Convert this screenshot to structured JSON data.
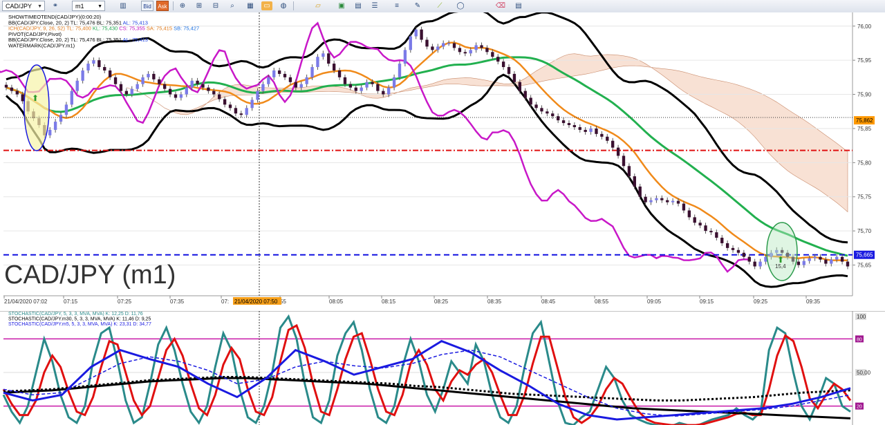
{
  "toolbar": {
    "symbol": "CAD/JPY",
    "timeframe": "m1",
    "bid_label": "Bid",
    "ask_label": "Ask",
    "icons": [
      "chart-type-icon",
      "bar-chart-icon",
      "crosshair-icon",
      "zoom-in-icon",
      "zoom-out-icon",
      "magnifier-icon",
      "indicator-icon",
      "globe-icon",
      "ruler-icon",
      "picture-icon",
      "template-icon",
      "list-icon",
      "lines-menu-icon",
      "pen-icon",
      "trendline-icon",
      "shape-icon",
      "eraser-icon",
      "properties-icon"
    ]
  },
  "chart_data": [
    {
      "type": "candlestick",
      "title": "CAD/JPY (m1)",
      "legend": [
        {
          "text": "SHOWTIMEOTEND(CAD/JPY)(0:00:20)",
          "color": "#000000"
        },
        {
          "parts": [
            {
              "text": "BB(CAD/JPY.Close, 20, 2)  TL: 75,476  BL: 75,351  ",
              "color": "#000000"
            },
            {
              "text": "AL: 75,413",
              "color": "#1a3fe0"
            }
          ]
        },
        {
          "parts": [
            {
              "text": "ICH(CAD/JPY, 9, 26, 52)  ",
              "color": "#e07a1a"
            },
            {
              "text": "TL: 75,400  ",
              "color": "#e07a1a"
            },
            {
              "text": "KL: 75,430  ",
              "color": "#1fa84f"
            },
            {
              "text": "CS: 75,355  ",
              "color": "#c010c0"
            },
            {
              "text": "SA: 75,415  ",
              "color": "#e07a1a"
            },
            {
              "text": "SB: 75,427",
              "color": "#1a6fe0"
            }
          ]
        },
        {
          "text": "PIVOT(CAD/JPY,Pivot)",
          "color": "#000000"
        },
        {
          "parts": [
            {
              "text": "BB(CAD/JPY.Close, 20, 2)  TL: 75,476  BL: 75,351  ",
              "color": "#000000"
            },
            {
              "text": "AL: 75,413",
              "color": "#1a3fe0"
            }
          ]
        },
        {
          "text": "WATERMARK(CAD/JPY.m1)",
          "color": "#000000"
        }
      ],
      "y_axis": {
        "ylim": [
          75.605,
          76.02
        ],
        "ticks": [
          "76,00",
          "75,95",
          "75,90",
          "75,85",
          "75,80",
          "75,75",
          "75,70",
          "75,65"
        ],
        "tick_values": [
          76.0,
          75.95,
          75.9,
          75.85,
          75.8,
          75.75,
          75.7,
          75.65
        ]
      },
      "x_axis": {
        "ticks": [
          "21/04/2020 07:02",
          "07:15",
          "07:25",
          "07:35",
          "07:",
          "55",
          "08:05",
          "08:15",
          "08:25",
          "08:35",
          "08:45",
          "08:55",
          "09:05",
          "09:15",
          "09:25",
          "09:35"
        ],
        "crosshair_label": "21/04/2020 07:50"
      },
      "price_markers": [
        {
          "label": "75,862",
          "value": 75.862,
          "color": "#ff9900"
        },
        {
          "label": "75,665",
          "value": 75.665,
          "color": "#1a1ae0"
        }
      ],
      "horizontal_lines": [
        {
          "value": 75.818,
          "color": "#e01010",
          "style": "dash-dot"
        },
        {
          "value": 75.665,
          "color": "#1010e0",
          "style": "dashed"
        }
      ],
      "annotations": [
        {
          "text": "15,4",
          "note": "arrow label"
        }
      ],
      "candles_close": [
        75.91,
        75.905,
        75.9,
        75.89,
        75.875,
        75.865,
        75.855,
        75.84,
        75.848,
        75.86,
        75.87,
        75.885,
        75.905,
        75.92,
        75.935,
        75.945,
        75.95,
        75.94,
        75.935,
        75.925,
        75.915,
        75.905,
        75.9,
        75.908,
        75.915,
        75.925,
        75.93,
        75.922,
        75.915,
        75.908,
        75.9,
        75.895,
        75.9,
        75.91,
        75.92,
        75.915,
        75.91,
        75.905,
        75.9,
        75.893,
        75.885,
        75.88,
        75.872,
        75.87,
        75.88,
        75.892,
        75.905,
        75.915,
        75.925,
        75.935,
        75.93,
        75.925,
        75.918,
        75.91,
        75.915,
        75.925,
        75.94,
        75.955,
        75.96,
        75.945,
        75.935,
        75.925,
        75.915,
        75.91,
        75.905,
        75.91,
        75.918,
        75.915,
        75.905,
        75.9,
        75.91,
        75.925,
        75.945,
        75.965,
        75.985,
        75.995,
        75.98,
        75.97,
        75.965,
        75.97,
        75.975,
        75.975,
        75.968,
        75.962,
        75.96,
        75.965,
        75.972,
        75.968,
        75.962,
        75.955,
        75.948,
        75.94,
        75.93,
        75.918,
        75.905,
        75.895,
        75.885,
        75.88,
        75.875,
        75.872,
        75.868,
        75.862,
        75.858,
        75.855,
        75.852,
        75.848,
        75.845,
        75.85,
        75.842,
        75.838,
        75.832,
        75.822,
        75.81,
        75.795,
        75.78,
        75.765,
        75.75,
        75.742,
        75.745,
        75.748,
        75.745,
        75.742,
        75.744,
        75.74,
        75.73,
        75.72,
        75.712,
        75.708,
        75.7,
        75.698,
        75.69,
        75.682,
        75.675,
        75.672,
        75.668,
        75.662,
        75.655,
        75.648,
        75.655,
        75.662,
        75.668,
        75.672,
        75.668,
        75.662,
        75.655,
        75.65,
        75.656,
        75.66,
        75.662,
        75.658,
        75.652,
        75.658,
        75.662,
        75.655,
        75.648
      ]
    },
    {
      "type": "line",
      "title": "",
      "legend": [
        {
          "text": "STOCHASTIC(CAD/JPY, 5, 3, 3, MVA, MVA)  K: 12,25  D: 11,76",
          "color": "#2a8a8a",
          "dcolor": "#e01010"
        },
        {
          "text": "STOCHASTIC(CAD/JPY.m30, 5, 3, 3, MVA, MVA)  K: 11,46  D: 9,25",
          "color": "#000000"
        },
        {
          "text": "STOCHASTIC(CAD/JPY.m5, 5, 3, 3, MVA, MVA)  K: 23,31  D: 34,77",
          "color": "#1a1ae0"
        }
      ],
      "y_axis": {
        "ylim": [
          0,
          100
        ],
        "ticks": [
          "100",
          "50,00"
        ],
        "tick_values": [
          100,
          50
        ]
      },
      "overbought": 80,
      "oversold": 20,
      "marker_labels": [
        "80",
        "20",
        "100"
      ],
      "series": [
        {
          "name": "K",
          "color": "#2a8a8a",
          "values": [
            30,
            15,
            5,
            20,
            50,
            80,
            60,
            30,
            10,
            5,
            20,
            60,
            85,
            90,
            60,
            25,
            5,
            10,
            40,
            75,
            90,
            70,
            40,
            15,
            5,
            20,
            55,
            85,
            70,
            35,
            10,
            5,
            20,
            50,
            90,
            100,
            80,
            40,
            10,
            5,
            25,
            65,
            85,
            95,
            70,
            35,
            10,
            5,
            20,
            55,
            80,
            60,
            30,
            15,
            35,
            60,
            50,
            40,
            75,
            60,
            30,
            10,
            5,
            20,
            55,
            85,
            95,
            60,
            25,
            5,
            3,
            10,
            15,
            35,
            55,
            45,
            25,
            12,
            8,
            5,
            3,
            2,
            2,
            5,
            3,
            2,
            5,
            8,
            10,
            12,
            18,
            12,
            8,
            15,
            70,
            90,
            85,
            50,
            20,
            8,
            25,
            45,
            40,
            20,
            15
          ]
        },
        {
          "name": "D",
          "color": "#e01010",
          "values": [
            35,
            22,
            12,
            12,
            25,
            50,
            65,
            55,
            33,
            15,
            12,
            28,
            55,
            78,
            75,
            50,
            25,
            12,
            20,
            45,
            70,
            80,
            65,
            40,
            18,
            12,
            30,
            57,
            72,
            62,
            35,
            15,
            12,
            28,
            60,
            88,
            92,
            72,
            40,
            15,
            12,
            35,
            62,
            82,
            85,
            62,
            35,
            15,
            12,
            30,
            58,
            70,
            57,
            35,
            25,
            42,
            52,
            48,
            57,
            62,
            50,
            30,
            12,
            12,
            30,
            58,
            82,
            82,
            55,
            28,
            10,
            5,
            10,
            20,
            35,
            45,
            40,
            27,
            15,
            8,
            5,
            4,
            3,
            3,
            3,
            3,
            4,
            6,
            8,
            10,
            13,
            14,
            12,
            12,
            35,
            65,
            83,
            78,
            55,
            27,
            18,
            30,
            40,
            35,
            25
          ]
        },
        {
          "name": "K m30",
          "color": "#000000",
          "values": [
            32,
            33,
            34,
            36,
            38,
            40,
            42,
            43,
            44,
            45,
            45,
            44,
            43,
            42,
            41,
            40,
            38,
            36,
            34,
            32,
            30,
            28,
            26,
            24,
            22,
            20,
            18,
            17,
            16,
            15,
            14,
            13,
            12,
            11,
            10,
            9
          ]
        },
        {
          "name": "D m30",
          "color": "#000000",
          "style": "dotted",
          "values": [
            33,
            34,
            35,
            37,
            39,
            41,
            43,
            44,
            45,
            46,
            46,
            45,
            44,
            43,
            42,
            41,
            40,
            38,
            37,
            35,
            33,
            31,
            30,
            29,
            28,
            27,
            26,
            25,
            25,
            26,
            27,
            28,
            30,
            32,
            33,
            34
          ]
        },
        {
          "name": "K m5",
          "color": "#1a1ae0",
          "values": [
            32,
            25,
            30,
            55,
            70,
            62,
            55,
            40,
            28,
            45,
            70,
            60,
            48,
            55,
            62,
            78,
            68,
            52,
            38,
            22,
            12,
            8,
            10,
            12,
            14,
            16,
            18,
            22,
            28,
            36
          ]
        },
        {
          "name": "D m5",
          "color": "#1a1ae0",
          "style": "dashed",
          "values": [
            35,
            30,
            32,
            45,
            58,
            64,
            60,
            52,
            40,
            44,
            55,
            60,
            56,
            54,
            58,
            66,
            70,
            64,
            52,
            40,
            28,
            18,
            13,
            11,
            13,
            15,
            17,
            20,
            25,
            30
          ]
        }
      ]
    }
  ]
}
